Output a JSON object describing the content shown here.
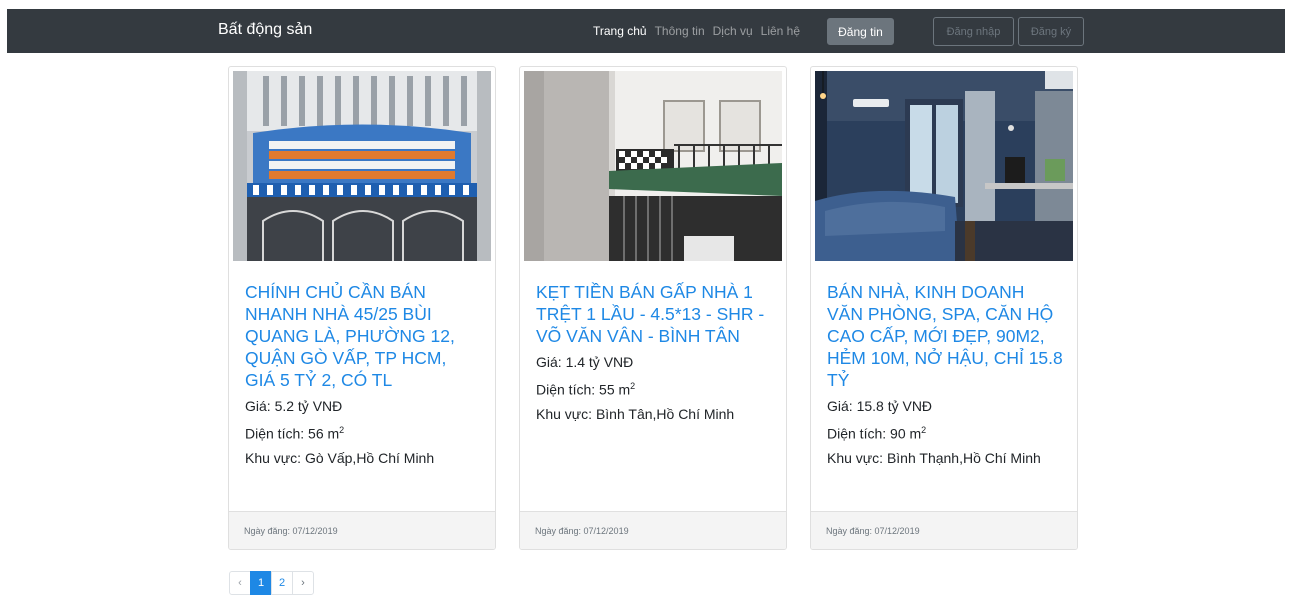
{
  "navbar": {
    "brand": "Bất động sản",
    "links": [
      {
        "label": "Trang chủ"
      },
      {
        "label": "Thông tin"
      },
      {
        "label": "Dịch vụ"
      },
      {
        "label": "Liên hệ"
      }
    ],
    "post_label": "Đăng tin",
    "login_label": "Đăng nhập",
    "register_label": "Đăng ký"
  },
  "listings": [
    {
      "title": "CHÍNH CHỦ CẦN BÁN NHANH NHÀ 45/25 BÙI QUANG LÀ, PHƯỜNG 12, QUẬN GÒ VẤP, TP HCM, GIÁ 5 TỶ 2, CÓ TL",
      "price": "Giá: 5.2 tỷ VNĐ",
      "area_label": "Diện tích: 56 m",
      "area_sup": "2",
      "location": "Khu vực: Gò Vấp,Hồ Chí Minh",
      "date": "Ngày đăng: 07/12/2019"
    },
    {
      "title": "KẸT TIỀN BÁN GẤP NHÀ 1 TRỆT 1 LẦU - 4.5*13 - SHR - VÕ VĂN VÂN - BÌNH TÂN",
      "price": "Giá: 1.4 tỷ VNĐ",
      "area_label": "Diện tích: 55 m",
      "area_sup": "2",
      "location": "Khu vực: Bình Tân,Hồ Chí Minh",
      "date": "Ngày đăng: 07/12/2019"
    },
    {
      "title": "BÁN NHÀ, KINH DOANH VĂN PHÒNG, SPA, CĂN HỘ CAO CẤP, MỚI ĐẸP, 90M2, HẺM 10M, NỞ HẬU, CHỈ 15.8 TỶ",
      "price": "Giá: 15.8 tỷ VNĐ",
      "area_label": "Diện tích: 90 m",
      "area_sup": "2",
      "location": "Khu vực: Bình Thạnh,Hồ Chí Minh",
      "date": "Ngày đăng: 07/12/2019"
    }
  ],
  "pagination": {
    "prev": "‹",
    "pages": [
      "1",
      "2"
    ],
    "next": "›",
    "current": "1"
  },
  "colors": {
    "navbar_bg": "#343a40",
    "link_blue": "#1e88e5",
    "footer_bg": "#f4f4f4"
  }
}
